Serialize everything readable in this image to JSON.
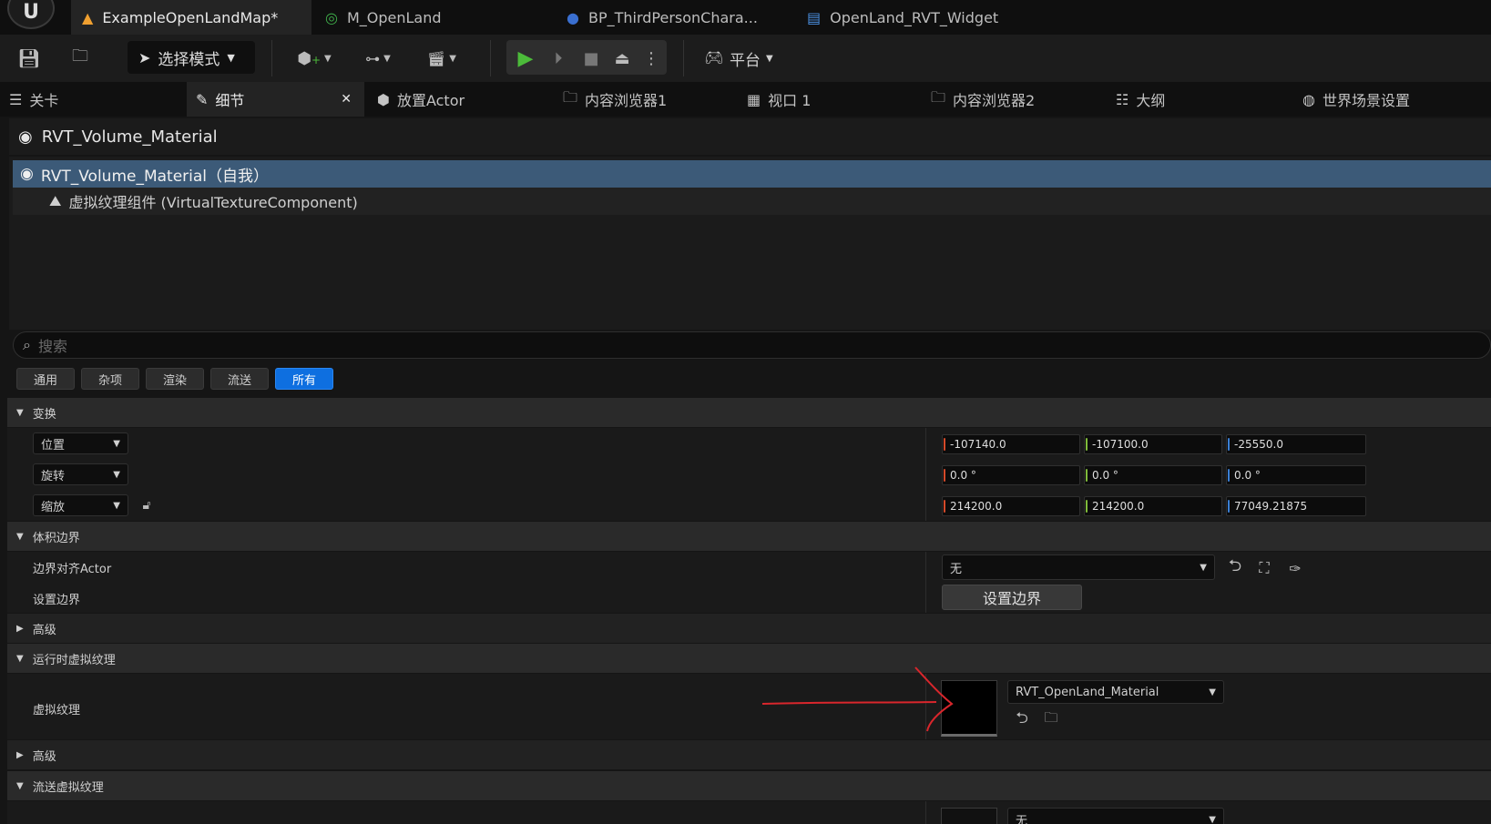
{
  "file_tabs": [
    {
      "label": "ExampleOpenLandMap*",
      "icon": "level-warning-icon"
    },
    {
      "label": "M_OpenLand",
      "icon": "material-icon"
    },
    {
      "label": "BP_ThirdPersonChara...",
      "icon": "character-icon"
    },
    {
      "label": "OpenLand_RVT_Widget",
      "icon": "widget-icon"
    }
  ],
  "toolbar": {
    "mode_label": "选择模式",
    "platform_label": "平台"
  },
  "panel_tabs": [
    {
      "label": "关卡"
    },
    {
      "label": "细节"
    },
    {
      "label": "放置Actor"
    },
    {
      "label": "内容浏览器1"
    },
    {
      "label": "视口 1"
    },
    {
      "label": "内容浏览器2"
    },
    {
      "label": "大纲"
    },
    {
      "label": "世界场景设置"
    }
  ],
  "details": {
    "object_name": "RVT_Volume_Material",
    "tree": [
      {
        "label": "RVT_Volume_Material（自我）"
      },
      {
        "label": "虚拟纹理组件 (VirtualTextureComponent)"
      }
    ],
    "search_placeholder": "搜索",
    "filters": [
      "通用",
      "杂项",
      "渲染",
      "流送",
      "所有"
    ],
    "active_filter": "所有"
  },
  "transform": {
    "section": "变换",
    "location_label": "位置",
    "rotation_label": "旋转",
    "scale_label": "缩放",
    "location": [
      "-107140.0",
      "-107100.0",
      "-25550.0"
    ],
    "rotation": [
      "0.0 °",
      "0.0 °",
      "0.0 °"
    ],
    "scale": [
      "214200.0",
      "214200.0",
      "77049.21875"
    ]
  },
  "volume_bounds": {
    "section": "体积边界",
    "align_actor_label": "边界对齐Actor",
    "align_actor_value": "无",
    "set_bounds_label": "设置边界",
    "set_bounds_button": "设置边界",
    "advanced": "高级"
  },
  "runtime_vt": {
    "section": "运行时虚拟纹理",
    "vt_label": "虚拟纹理",
    "vt_value": "RVT_OpenLand_Material",
    "advanced": "高级"
  },
  "streaming_vt": {
    "section": "流送虚拟纹理",
    "value": "无"
  },
  "colors": {
    "selection": "#3c5a78",
    "active_filter": "#0e6fe0",
    "play_green": "#4cbb3a",
    "annotation_red": "#d9262c"
  }
}
